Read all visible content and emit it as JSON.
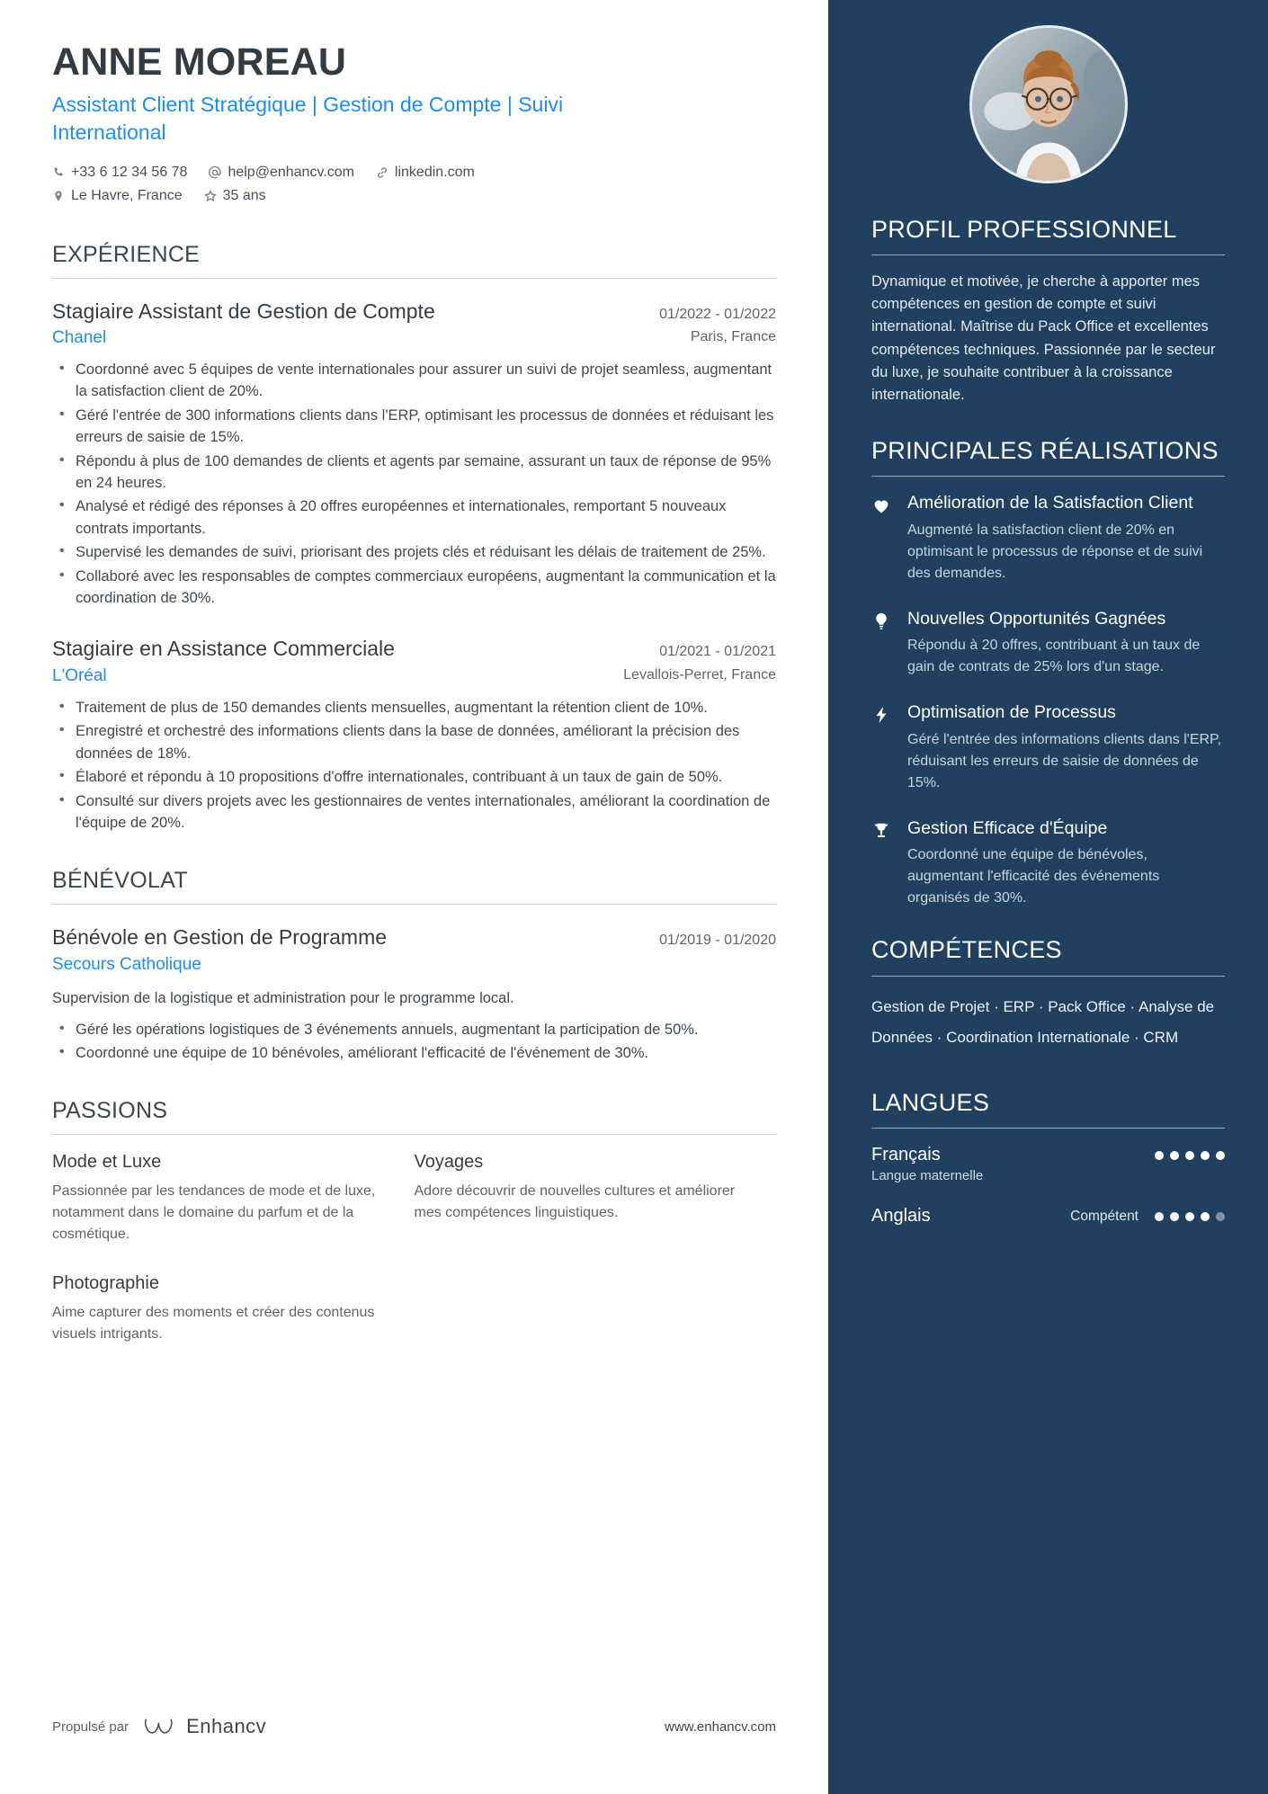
{
  "person": {
    "name": "ANNE MOREAU",
    "headline": "Assistant Client Stratégique | Gestion de Compte | Suivi International",
    "phone": "+33 6 12 34 56 78",
    "email": "help@enhancv.com",
    "linkedin": "linkedin.com",
    "location": "Le Havre, France",
    "age": "35 ans"
  },
  "colors": {
    "sidebar_bg": "#21405f",
    "accent_blue": "#1f8cf0",
    "heading_dark": "#3c464d",
    "body_text": "#3f4950"
  },
  "sections": {
    "experience": {
      "title": "EXPÉRIENCE",
      "entries": [
        {
          "title": "Stagiaire Assistant de Gestion de Compte",
          "date": "01/2022 - 01/2022",
          "org": "Chanel",
          "location": "Paris, France",
          "bullets": [
            "Coordonné avec 5 équipes de vente internationales pour assurer un suivi de projet seamless, augmentant la satisfaction client de 20%.",
            "Géré l'entrée de 300 informations clients dans l'ERP, optimisant les processus de données et réduisant les erreurs de saisie de 15%.",
            "Répondu à plus de 100 demandes de clients et agents par semaine, assurant un taux de réponse de 95% en 24 heures.",
            "Analysé et rédigé des réponses à 20 offres européennes et internationales, remportant 5 nouveaux contrats importants.",
            "Supervisé les demandes de suivi, priorisant des projets clés et réduisant les délais de traitement de 25%.",
            "Collaboré avec les responsables de comptes commerciaux européens, augmentant la communication et la coordination de 30%."
          ]
        },
        {
          "title": "Stagiaire en Assistance Commerciale",
          "date": "01/2021 - 01/2021",
          "org": "L'Oréal",
          "location": "Levallois-Perret, France",
          "bullets": [
            "Traitement de plus de 150 demandes clients mensuelles, augmentant la rétention client de 10%.",
            "Enregistré et orchestré des informations clients dans la base de données, améliorant la précision des données de 18%.",
            "Élaboré et répondu à 10 propositions d'offre internationales, contribuant à un taux de gain de 50%.",
            "Consulté sur divers projets avec les gestionnaires de ventes internationales, améliorant la coordination de l'équipe de 20%."
          ]
        }
      ]
    },
    "volunteering": {
      "title": "BÉNÉVOLAT",
      "entries": [
        {
          "title": "Bénévole en Gestion de Programme",
          "date": "01/2019 - 01/2020",
          "org": "Secours Catholique",
          "location": "",
          "intro": "Supervision de la logistique et administration pour le programme local.",
          "bullets": [
            "Géré les opérations logistiques de 3 événements annuels, augmentant la participation de 50%.",
            "Coordonné une équipe de 10 bénévoles, améliorant l'efficacité de l'événement de 30%."
          ]
        }
      ]
    },
    "passions": {
      "title": "PASSIONS",
      "items": [
        {
          "title": "Mode et Luxe",
          "desc": "Passionnée par les tendances de mode et de luxe, notamment dans le domaine du parfum et de la cosmétique."
        },
        {
          "title": "Voyages",
          "desc": "Adore découvrir de nouvelles cultures et améliorer mes compétences linguistiques."
        },
        {
          "title": "Photographie",
          "desc": "Aime capturer des moments et créer des contenus visuels intrigants."
        }
      ]
    },
    "profile": {
      "title": "PROFIL PROFESSIONNEL",
      "body": "Dynamique et motivée, je cherche à apporter mes compétences en gestion de compte et suivi international. Maîtrise du Pack Office et excellentes compétences techniques. Passionnée par le secteur du luxe, je souhaite contribuer à la croissance internationale."
    },
    "achievements": {
      "title": "PRINCIPALES RÉALISATIONS",
      "items": [
        {
          "icon": "heart-icon",
          "title": "Amélioration de la Satisfaction Client",
          "desc": "Augmenté la satisfaction client de 20% en optimisant le processus de réponse et de suivi des demandes."
        },
        {
          "icon": "lightbulb-icon",
          "title": "Nouvelles Opportunités Gagnées",
          "desc": "Répondu à 20 offres, contribuant à un taux de gain de contrats de 25% lors d'un stage."
        },
        {
          "icon": "lightning-bolt-icon",
          "title": "Optimisation de Processus",
          "desc": "Géré l'entrée des informations clients dans l'ERP, réduisant les erreurs de saisie de données de 15%."
        },
        {
          "icon": "trophy-icon",
          "title": "Gestion Efficace d'Équipe",
          "desc": "Coordonné une équipe de bénévoles, augmentant l'efficacité des événements organisés de 30%."
        }
      ]
    },
    "skills": {
      "title": "COMPÉTENCES",
      "text": "Gestion de Projet · ERP · Pack Office · Analyse de Données · Coordination Internationale · CRM"
    },
    "languages": {
      "title": "LANGUES",
      "items": [
        {
          "name": "Français",
          "sub": "Langue maternelle",
          "level": "",
          "filled": 5,
          "total": 5
        },
        {
          "name": "Anglais",
          "sub": "",
          "level": "Compétent",
          "filled": 4,
          "total": 5
        }
      ]
    }
  },
  "footer": {
    "powered_by": "Propulsé par",
    "brand": "Enhancv",
    "url": "www.enhancv.com"
  }
}
